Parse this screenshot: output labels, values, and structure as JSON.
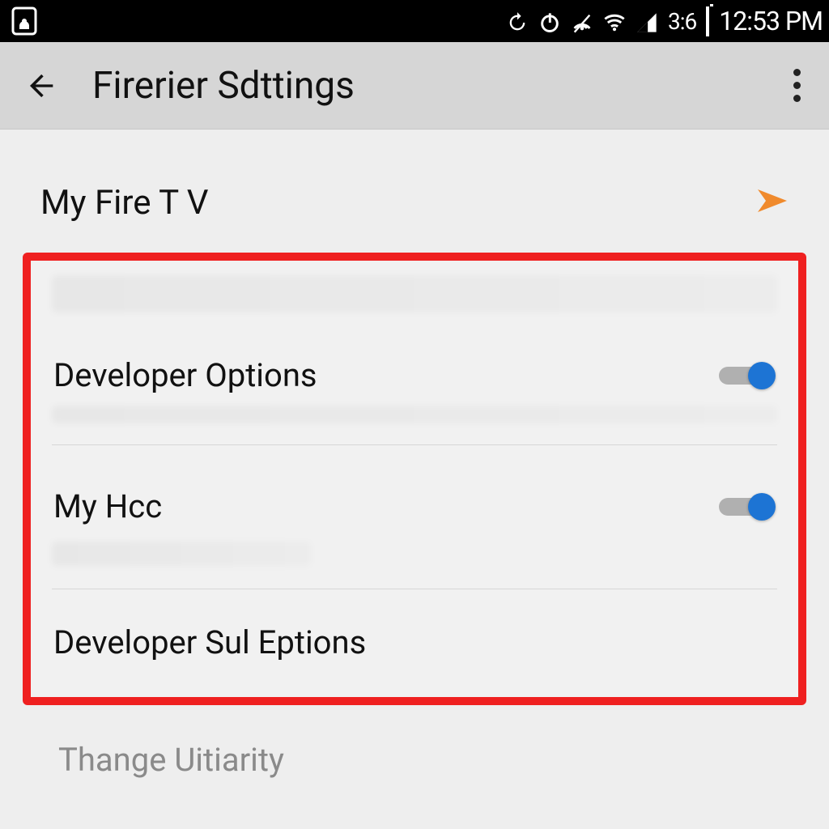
{
  "status_bar": {
    "time": "12:53 PM",
    "secondary": "3:6",
    "icons": [
      "rotate-icon",
      "power-icon",
      "hotspot-icon",
      "wifi-icon",
      "cellular-icon",
      "battery-icon"
    ]
  },
  "app_bar": {
    "title": "Firerier Sdttings"
  },
  "content": {
    "header": "My Fire T V",
    "items": [
      {
        "label": "Developer Options",
        "toggle": true
      },
      {
        "label": "My Hcc",
        "toggle": true
      },
      {
        "label": "Developer Sul Eptions"
      }
    ],
    "footer": "Thange Uitiarity"
  },
  "colors": {
    "highlight_border": "#ef2020",
    "toggle_on": "#1d74d4",
    "orange_arrow": "#f08a2c"
  }
}
